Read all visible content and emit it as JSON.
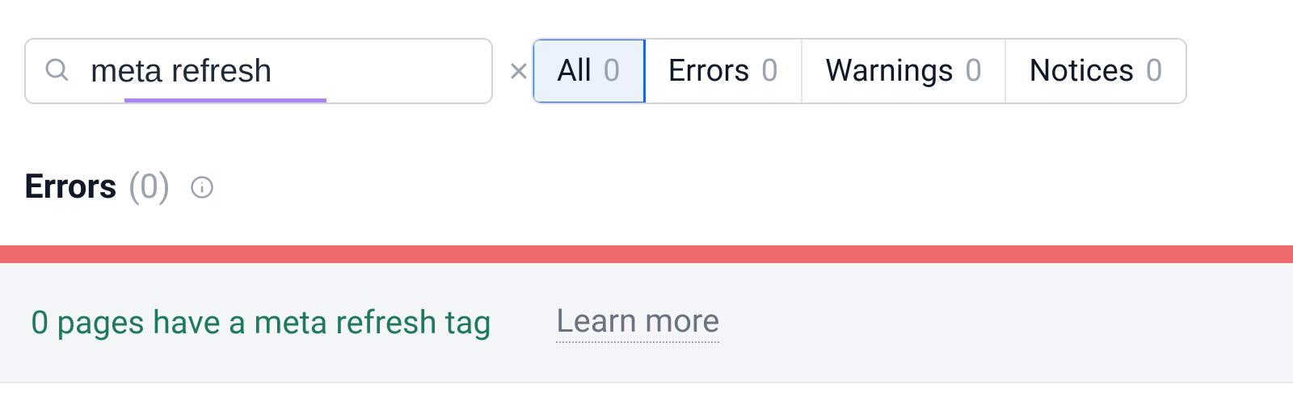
{
  "search": {
    "value": "meta refresh"
  },
  "filters": {
    "all": {
      "label": "All",
      "count": "0"
    },
    "errors": {
      "label": "Errors",
      "count": "0"
    },
    "warnings": {
      "label": "Warnings",
      "count": "0"
    },
    "notices": {
      "label": "Notices",
      "count": "0"
    }
  },
  "section": {
    "title": "Errors",
    "count": "(0)"
  },
  "result": {
    "message": "0 pages have a meta refresh tag",
    "learn_more": "Learn more"
  }
}
